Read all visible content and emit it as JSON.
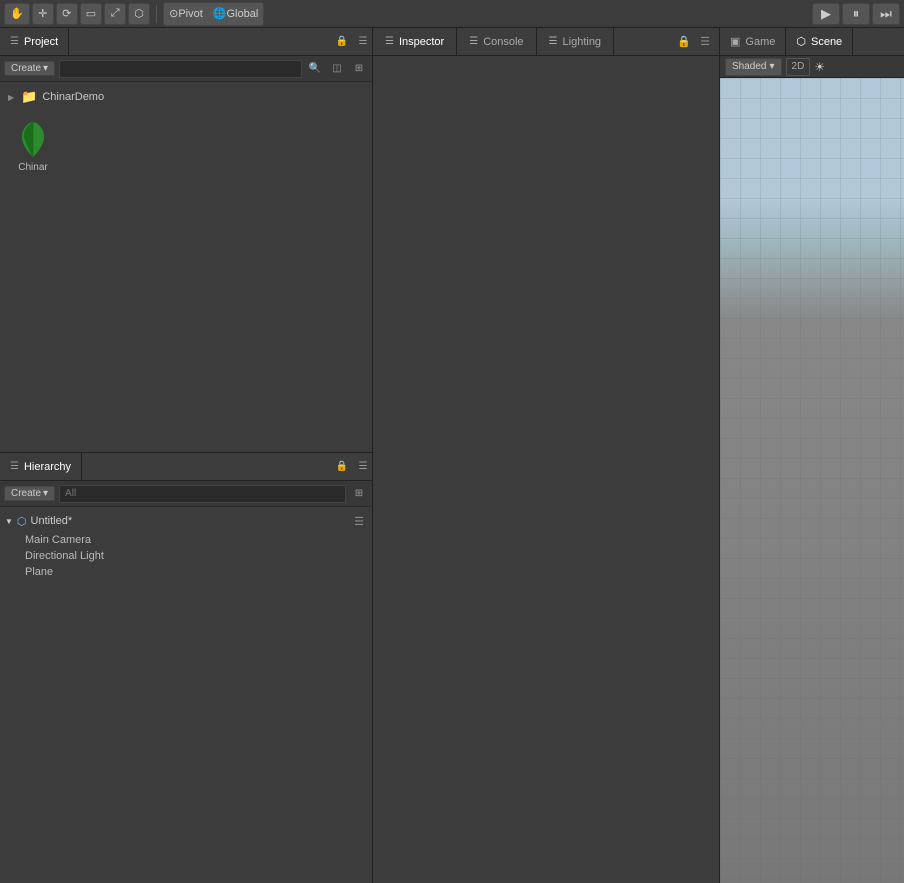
{
  "toolbar": {
    "hand_tool": "✋",
    "move_tool": "✛",
    "rotate_tool": "⟳",
    "rect_tool": "▭",
    "scale_tool": "⤢",
    "transform_tool": "⬡",
    "pivot_label": "Pivot",
    "global_label": "Global",
    "play_icon": "▶",
    "pause_icon": "⏸",
    "step_icon": "⏭"
  },
  "project_panel": {
    "tab_label": "Project",
    "tab_icon": "☰",
    "create_label": "Create",
    "create_arrow": "▾",
    "search_placeholder": "",
    "folder_name": "ChinarDemo",
    "asset_name": "Chinar",
    "lock_icon": "🔒",
    "menu_icon": "☰"
  },
  "hierarchy_panel": {
    "tab_label": "Hierarchy",
    "tab_icon": "☰",
    "create_label": "Create",
    "search_placeholder": "All",
    "scene_name": "Untitled*",
    "items": [
      {
        "name": "Main Camera"
      },
      {
        "name": "Directional Light"
      },
      {
        "name": "Plane"
      }
    ],
    "scene_icon": "⬡",
    "lock_icon": "🔒",
    "menu_icon": "☰",
    "filter_icon": "⊞"
  },
  "inspector_panel": {
    "tab_label": "Inspector",
    "tab_icon": "☰",
    "console_label": "Console",
    "console_icon": "☰",
    "lighting_label": "Lighting",
    "lighting_icon": "☰",
    "lock_icon": "🔒",
    "menu_icon": "☰"
  },
  "game_panel": {
    "tab_label": "Game",
    "game_icon": "▣",
    "scene_label": "Scene",
    "scene_icon": "⬡"
  },
  "scene_view": {
    "shaded_label": "Shaded",
    "shaded_arrow": "▾",
    "mode_2d": "2D",
    "sun_icon": "☀"
  }
}
